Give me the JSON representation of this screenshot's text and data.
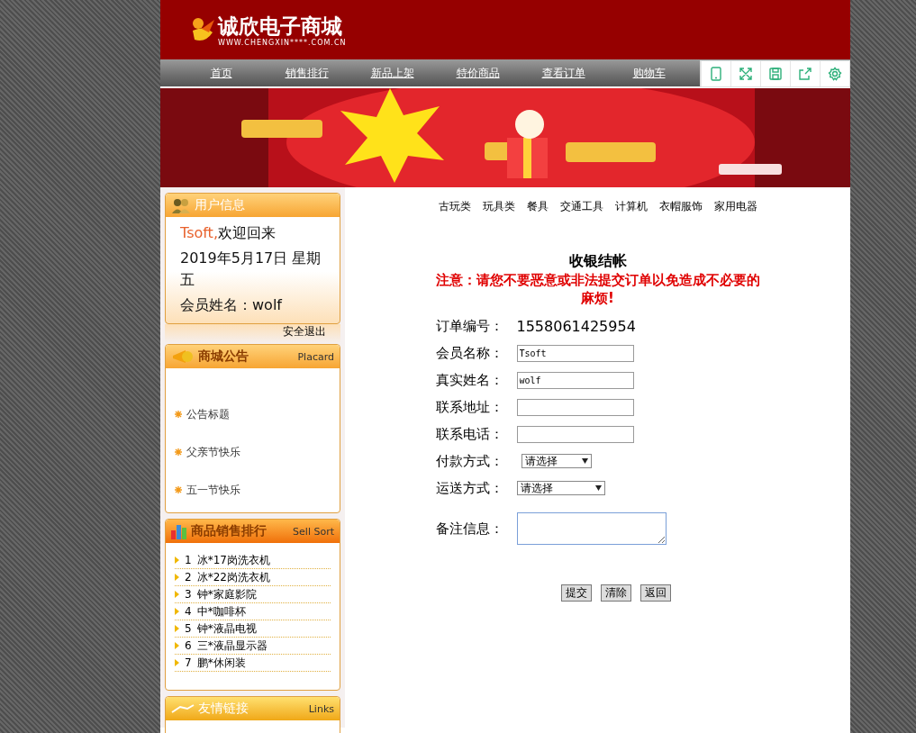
{
  "logo": {
    "name": "诚欣电子商城",
    "url": "WWW.CHENGXIN****.COM.CN"
  },
  "nav": [
    "首页",
    "销售排行",
    "新品上架",
    "特价商品",
    "查看订单",
    "购物车"
  ],
  "banner": {
    "kind": "picture"
  },
  "user_panel": {
    "title": "用户信息",
    "username": "Tsoft,",
    "welcome": "欢迎回来",
    "date": "2019年5月17日 星期五",
    "member_name": "会员姓名：wolf",
    "logout": "安全退出"
  },
  "notice_panel": {
    "title": "商城公告",
    "subtitle": "Placard",
    "items": [
      "公告标题",
      "父亲节快乐",
      "五一节快乐"
    ]
  },
  "sales_panel": {
    "title": "商品销售排行",
    "subtitle": "Sell Sort",
    "items": [
      {
        "rank": "1",
        "name": "冰*17岗洗衣机"
      },
      {
        "rank": "2",
        "name": "冰*22岗洗衣机"
      },
      {
        "rank": "3",
        "name": "钟*家庭影院"
      },
      {
        "rank": "4",
        "name": "中*咖啡杯"
      },
      {
        "rank": "5",
        "name": "钟*液晶电视"
      },
      {
        "rank": "6",
        "name": "三*液晶显示器"
      },
      {
        "rank": "7",
        "name": "鹏*休闲装"
      }
    ]
  },
  "links_panel": {
    "title": "友情链接",
    "subtitle": "Links"
  },
  "categories": [
    "古玩类",
    "玩具类",
    "餐具",
    "交通工具",
    "计算机",
    "衣帽服饰",
    "家用电器"
  ],
  "checkout": {
    "title": "收银结帐",
    "warning": "注意：请您不要恶意或非法提交订单以免造成不必要的麻烦!",
    "fields": [
      {
        "kind": "text",
        "label": "订单编号：",
        "value": "1558061425954"
      },
      {
        "kind": "input",
        "label": "会员名称：",
        "value": "Tsoft"
      },
      {
        "kind": "input",
        "label": "真实姓名：",
        "value": "wolf"
      },
      {
        "kind": "input",
        "label": "联系地址："
      },
      {
        "kind": "input",
        "label": "联系电话："
      },
      {
        "kind": "select",
        "label": "付款方式：",
        "value": "请选择"
      },
      {
        "kind": "select",
        "label": "运送方式：",
        "value": "请选择"
      },
      {
        "kind": "textarea",
        "label": "备注信息："
      }
    ],
    "buttons": [
      "提交",
      "清除",
      "返回"
    ]
  }
}
